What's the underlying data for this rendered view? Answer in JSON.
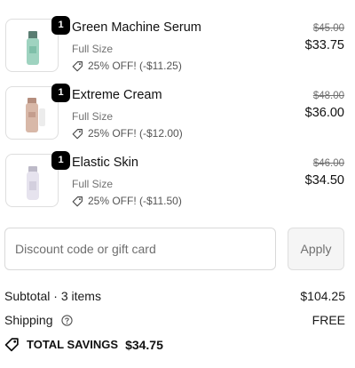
{
  "items": [
    {
      "quantity": "1",
      "name": "Green Machine Serum",
      "variant": "Full Size",
      "discount": "25% OFF! (-$11.25)",
      "original_price": "$45.00",
      "price": "$33.75",
      "image_icon": "serum-bottle-icon",
      "image_color": "#9fd3c0"
    },
    {
      "quantity": "1",
      "name": "Extreme Cream",
      "variant": "Full Size",
      "discount": "25% OFF! (-$12.00)",
      "original_price": "$48.00",
      "price": "$36.00",
      "image_icon": "cream-bottle-icon",
      "image_color": "#d8b8a8"
    },
    {
      "quantity": "1",
      "name": "Elastic Skin",
      "variant": "Full Size",
      "discount": "25% OFF! (-$11.50)",
      "original_price": "$46.00",
      "price": "$34.50",
      "image_icon": "lotion-bottle-icon",
      "image_color": "#e6e3ee"
    }
  ],
  "discount_field": {
    "placeholder": "Discount code or gift card",
    "value": ""
  },
  "apply_button": {
    "label": "Apply"
  },
  "summary": {
    "subtotal_label": "Subtotal · 3 items",
    "subtotal_value": "$104.25",
    "shipping_label": "Shipping",
    "shipping_value": "FREE",
    "total_savings_label": "TOTAL SAVINGS",
    "total_savings_value": "$34.75"
  },
  "icons": {
    "tag": "tag-icon",
    "help": "help-circle-icon"
  },
  "colors": {
    "badge": "#000000",
    "muted_text": "#707070",
    "input_border": "#d9d9d9",
    "button_bg": "#f5f5f5"
  }
}
